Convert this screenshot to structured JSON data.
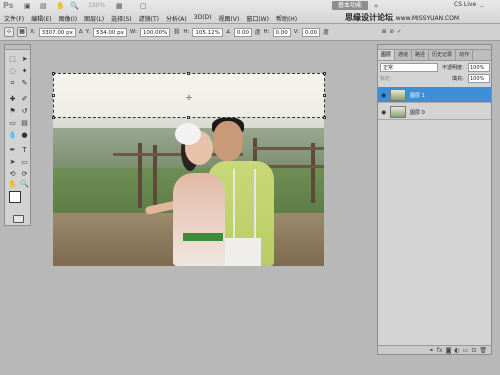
{
  "app": {
    "logo": "Ps",
    "zoom": "100%",
    "workspace_button": "基本功能",
    "cslive_label": "CS Live",
    "watermark": "思缘设计论坛",
    "watermark_url": "www.MISSYUAN.COM"
  },
  "menus": [
    "文件(F)",
    "编辑(E)",
    "图像(I)",
    "图层(L)",
    "选择(S)",
    "滤镜(T)",
    "分析(A)",
    "3D(D)",
    "视图(V)",
    "窗口(W)",
    "帮助(H)"
  ],
  "options": {
    "x_label": "X:",
    "x_value": "3307.00 px",
    "y_label": "Y:",
    "y_value": "534.00 px",
    "w_label": "W:",
    "w_value": "100.00%",
    "h_label": "H:",
    "h_value": "105.12%",
    "rot_value": "0.00",
    "rot_unit": "度",
    "h_skew_label": "H:",
    "h_skew_value": "0.00",
    "v_skew_label": "V:",
    "v_skew_value": "0.00",
    "skew_unit": "度",
    "cancel_icon": "cancel-icon",
    "commit_icon": "commit-icon"
  },
  "layers_panel": {
    "tabs": [
      "图层",
      "通道",
      "路径",
      "历史记录",
      "动作"
    ],
    "blend_mode": "正常",
    "opacity_label": "不透明度:",
    "opacity": "100%",
    "lock_label": "锁定:",
    "fill_label": "填充:",
    "fill": "100%",
    "layers": [
      {
        "name": "图层 1",
        "visible": true,
        "selected": true
      },
      {
        "name": "图层 0",
        "visible": true,
        "selected": false
      }
    ]
  },
  "colors": {
    "selection_highlight": "#3f8fd8",
    "panel_bg": "#d4d4d4",
    "workspace_bg": "#b8b8b8"
  }
}
